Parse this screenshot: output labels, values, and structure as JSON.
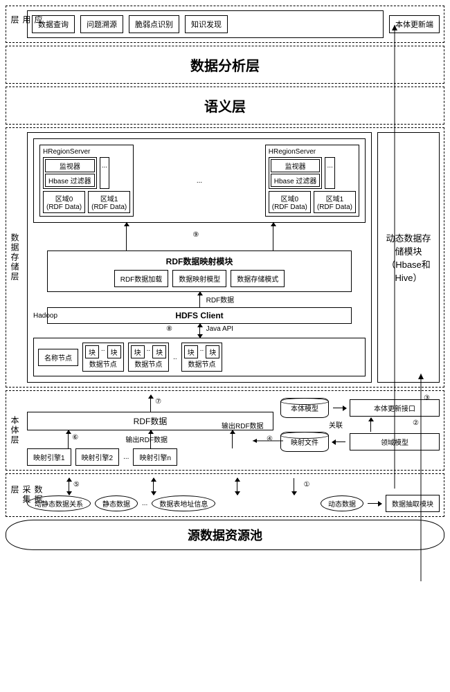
{
  "layers": {
    "app": {
      "label": "应用层",
      "items": [
        "数据查询",
        "问题溯源",
        "脆弱点识别",
        "知识发现"
      ],
      "update_end": "本体更新端"
    },
    "analysis": {
      "title": "数据分析层"
    },
    "semantic": {
      "title": "语义层"
    },
    "storage": {
      "label": "数据存储层",
      "hregion": {
        "title": "HRegionServer",
        "monitor": "监视器",
        "filter": "Hbase 过滤器",
        "region0": "区域0",
        "region1": "区域1",
        "rdf": "(RDF Data)",
        "dots": "..."
      },
      "mapping": {
        "title": "RDF数据映射模块",
        "load": "RDF数据加载",
        "model": "数据映射模型",
        "mode": "数据存储模式",
        "rdf_data": "RDF数据"
      },
      "hdfs": {
        "title": "HDFS Client",
        "api": "Java API"
      },
      "hadoop": {
        "label": "Hadoop",
        "name_node": "名称节点",
        "block": "块",
        "data_node": "数据节点",
        "dots": ".."
      },
      "dynamic_module": "动态数据存储模块（Hbase和Hive）"
    },
    "ontology": {
      "label": "本体层",
      "rdf_data": "RDF数据",
      "output_rdf": "输出RDF数据",
      "engine1": "映射引擎1",
      "engine2": "映射引擎2",
      "enginen": "映射引擎n",
      "dots": "...",
      "ontology_model": "本体模型",
      "mapping_file": "映射文件",
      "relation": "关联",
      "domain_model": "领域模型",
      "update_iface": "本体更新接口"
    },
    "collect": {
      "label": "数据采集层",
      "rel": "动静态数据关系",
      "static": "静态数据",
      "addr": "数据表地址信息",
      "dots": "...",
      "dynamic": "动态数据",
      "extract": "数据抽取模块"
    },
    "pool": {
      "title": "源数据资源池"
    }
  },
  "nums": {
    "n1": "①",
    "n2": "②",
    "n3": "③",
    "n4": "④",
    "n5": "⑤",
    "n6": "⑥",
    "n7": "⑦",
    "n8": "⑧",
    "n9": "⑨"
  }
}
